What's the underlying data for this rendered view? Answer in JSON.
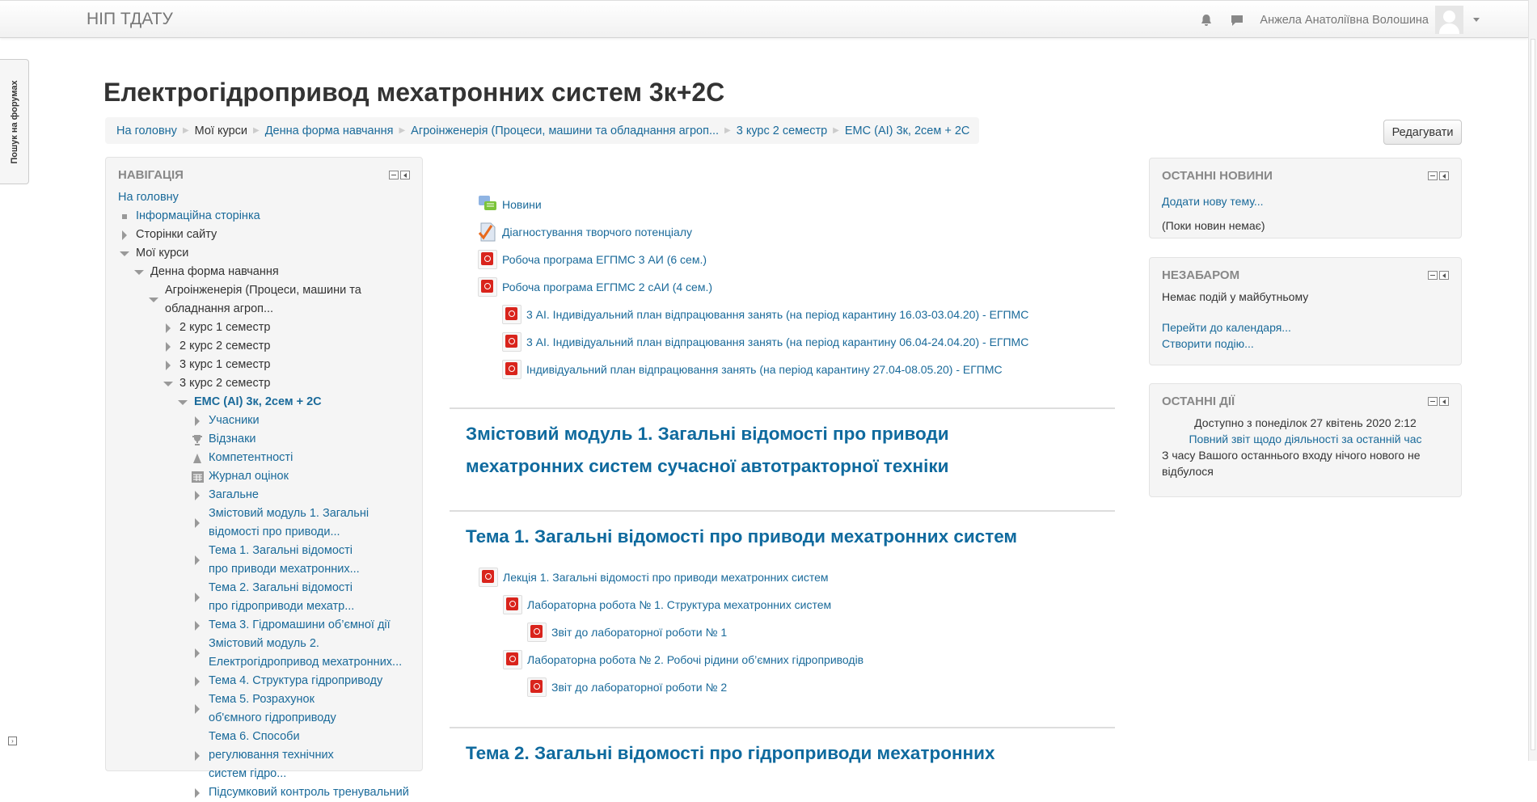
{
  "header": {
    "brand": "НІП ТДАТУ",
    "user_name": "Анжела Анатоліївна Волошина"
  },
  "side_tab": "Пошук на форумах",
  "page_title": "Електрогідропривод мехатронних систем 3к+2С",
  "breadcrumb": [
    "На головну",
    "Мої курси",
    "Денна форма навчання",
    "Агроінженерія (Процеси, машини та обладнання агроп...",
    "3 курс 2 семестр",
    "ЕМС (АІ) 3к, 2сем + 2С"
  ],
  "edit_button": "Редагувати",
  "navigation": {
    "title": "Навігація",
    "home": "На головну",
    "items": [
      "Інформаційна сторінка",
      "Сторінки сайту",
      "Мої курси",
      "Денна форма навчання",
      "Агроінженерія (Процеси, машини та обладнання агроп...",
      "2 курс 1 семестр",
      "2 курс 2 семестр",
      "3 курс 1 семестр",
      "3 курс 2 семестр",
      "ЕМС (АІ) 3к, 2сем + 2С",
      "Учасники",
      "Відзнаки",
      "Компетентності",
      "Журнал оцінок",
      "Загальне",
      "Змістовий модуль 1. Загальні відомості про приводи...",
      "Тема 1. Загальні відомості про приводи мехатронних...",
      "Тема 2. Загальні відомості про гідроприводи мехатр...",
      "Тема 3. Гідромашини об’ємної дії",
      "Змістовий модуль 2. Електрогідропривод мехатронних...",
      "Тема 4. Структура гідроприводу",
      "Тема 5. Розрахунок об'ємного гідроприводу",
      "Тема 6. Способи регулювання технічних систем гідро...",
      "Підсумковий контроль тренувальний"
    ]
  },
  "top_activities": [
    "Новини",
    "Діагностування творчого потенціалу",
    "Робоча програма ЕГПМС 3 АИ (6 сем.)",
    "Робоча програма ЕГПМС 2 сАИ (4 сем.)",
    "3 АІ. Індивідуальний план відпрацювання занять (на період карантину 16.03-03.04.20) - ЕГПМС",
    "3 АІ. Індивідуальний план відпрацювання занять (на період карантину 06.04-24.04.20) - ЕГПМС",
    "Індивідуальний план відпрацювання занять (на період карантину 27.04-08.05.20) - ЕГПМС"
  ],
  "sections": [
    {
      "title": "Змістовий модуль 1. Загальні відомості про приводи мехатронних систем сучасної автотракторної техніки"
    },
    {
      "title": "Тема 1. Загальні відомості про приводи мехатронних систем",
      "activities": [
        "Лекція 1. Загальні відомості про приводи мехатронних систем",
        "Лабораторна робота № 1. Структура мехатронних систем",
        "Звіт до лабораторної роботи № 1",
        "Лабораторна робота № 2. Робочі рідини об’ємних гідроприводів",
        "Звіт до лабораторної роботи № 2"
      ]
    },
    {
      "title": "Тема 2. Загальні відомості про гідроприводи мехатронних"
    }
  ],
  "news_block": {
    "title": "Останні новини",
    "add_link": "Додати нову тему...",
    "empty": "(Поки новин немає)"
  },
  "upcoming_block": {
    "title": "Незабаром",
    "empty": "Немає подій у майбутньому",
    "calendar_link": "Перейти до календаря...",
    "create_link": "Створити подію..."
  },
  "recent_block": {
    "title": "Останні дії",
    "since": "Доступно з понеділок 27 квітень 2020 2:12",
    "report_link": "Повний звіт щодо діяльності за останній час",
    "nothing": "З часу Вашого останнього входу нічого нового не відбулося"
  }
}
